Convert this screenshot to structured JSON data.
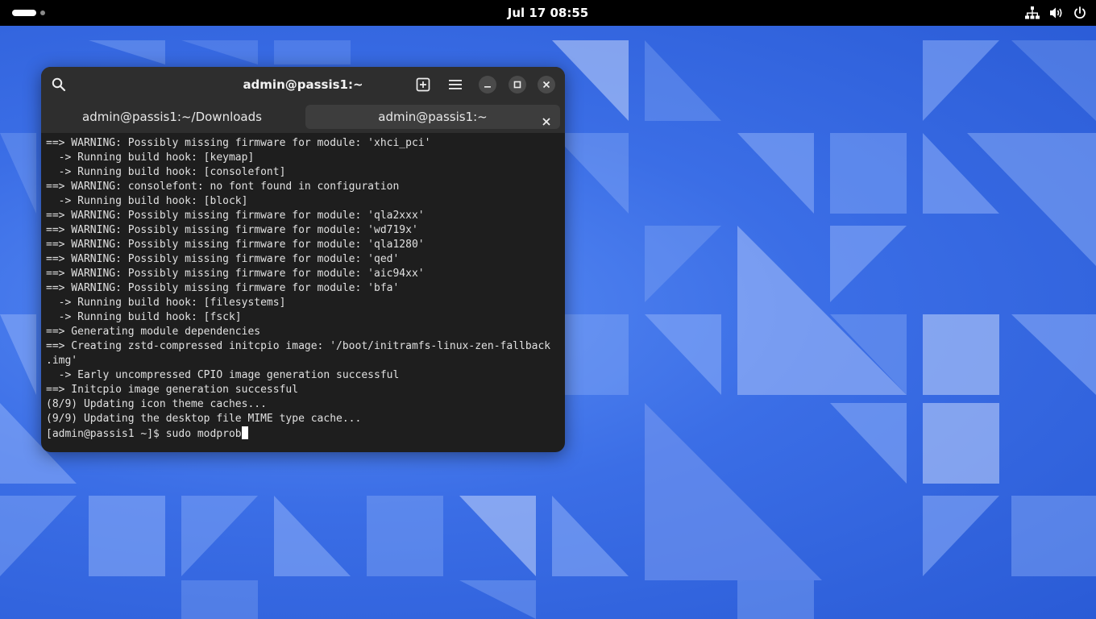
{
  "topbar": {
    "clock": "Jul 17  08:55",
    "icons": [
      "network-icon",
      "volume-icon",
      "power-icon"
    ]
  },
  "terminal": {
    "title": "admin@passis1:~",
    "tabs": [
      {
        "label": "admin@passis1:~/Downloads",
        "active": false
      },
      {
        "label": "admin@passis1:~",
        "active": true
      }
    ],
    "lines": [
      "==> WARNING: Possibly missing firmware for module: 'xhci_pci'",
      "  -> Running build hook: [keymap]",
      "  -> Running build hook: [consolefont]",
      "==> WARNING: consolefont: no font found in configuration",
      "  -> Running build hook: [block]",
      "==> WARNING: Possibly missing firmware for module: 'qla2xxx'",
      "==> WARNING: Possibly missing firmware for module: 'wd719x'",
      "==> WARNING: Possibly missing firmware for module: 'qla1280'",
      "==> WARNING: Possibly missing firmware for module: 'qed'",
      "==> WARNING: Possibly missing firmware for module: 'aic94xx'",
      "==> WARNING: Possibly missing firmware for module: 'bfa'",
      "  -> Running build hook: [filesystems]",
      "  -> Running build hook: [fsck]",
      "==> Generating module dependencies",
      "==> Creating zstd-compressed initcpio image: '/boot/initramfs-linux-zen-fallback",
      ".img'",
      "  -> Early uncompressed CPIO image generation successful",
      "==> Initcpio image generation successful",
      "(8/9) Updating icon theme caches...",
      "(9/9) Updating the desktop file MIME type cache..."
    ],
    "prompt": "[admin@passis1 ~]$ ",
    "command": "sudo modprob"
  },
  "colors": {
    "topbar_bg": "#000000",
    "terminal_bg": "#1e1e1e",
    "headerbar_bg": "#2e2e2e",
    "active_tab_bg": "#3d3d3d",
    "wallpaper_blue": "#3b6ee6"
  }
}
